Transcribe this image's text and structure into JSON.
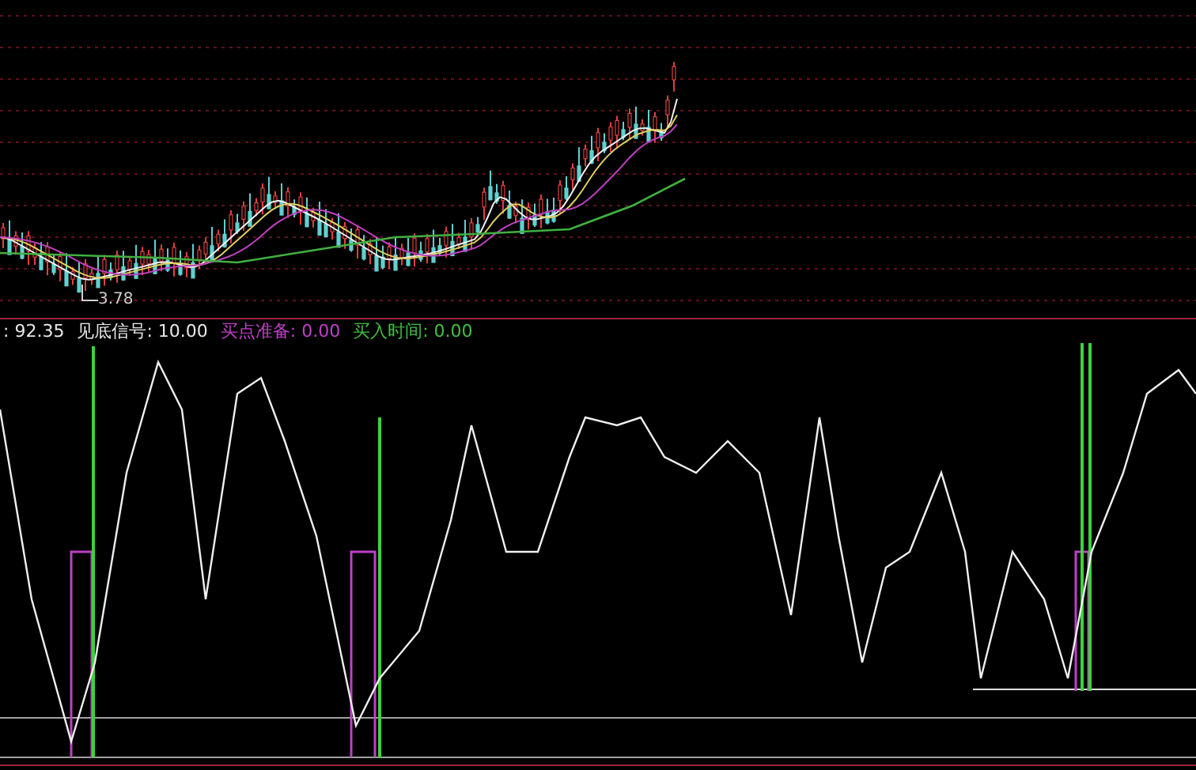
{
  "price_pane": {
    "low_label": "3.78"
  },
  "indicator": {
    "legend": [
      {
        "text": ": 92.35",
        "color": "#e8e8e8"
      },
      {
        "text": "见底信号: 10.00",
        "color": "#e8e8e8"
      },
      {
        "text": "买点准备: 0.00",
        "color": "#c040c8"
      },
      {
        "text": "买入时间: 0.00",
        "color": "#40c040"
      }
    ]
  }
}
